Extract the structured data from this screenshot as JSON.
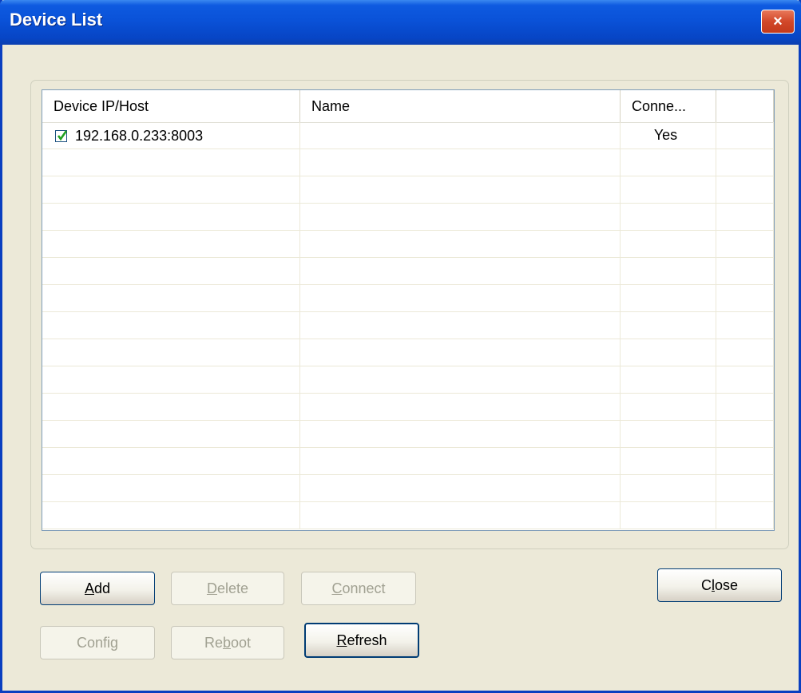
{
  "window": {
    "title": "Device List",
    "close_icon": "×"
  },
  "list": {
    "columns": [
      "Device IP/Host",
      "Name",
      "Conne...",
      ""
    ],
    "rows": [
      {
        "checked": true,
        "ip": "192.168.0.233:8003",
        "name": "",
        "connected": "Yes"
      }
    ],
    "empty_rows": 14
  },
  "buttons": {
    "add": {
      "pre": "",
      "mn": "A",
      "post": "dd"
    },
    "delete": {
      "pre": "",
      "mn": "D",
      "post": "elete"
    },
    "connect": {
      "pre": "",
      "mn": "C",
      "post": "onnect"
    },
    "config": {
      "pre": "Confi",
      "mn": "g",
      "post": ""
    },
    "reboot": {
      "pre": "Re",
      "mn": "b",
      "post": "oot"
    },
    "refresh": {
      "pre": "",
      "mn": "R",
      "post": "efresh"
    },
    "close": {
      "pre": "C",
      "mn": "l",
      "post": "ose"
    }
  },
  "colors": {
    "title_bar": "#0a52d8",
    "close_button": "#d2482a",
    "dialog_bg": "#ece9d8",
    "checkbox_check": "#21a121"
  }
}
